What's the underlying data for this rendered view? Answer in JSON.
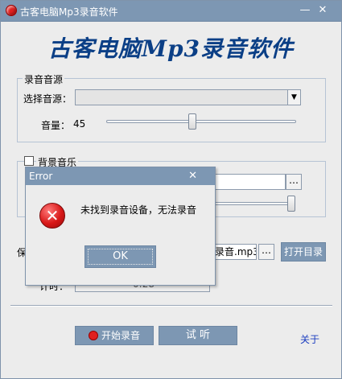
{
  "window": {
    "title": "古客电脑Mp3录音软件",
    "minimize_glyph": "—",
    "close_glyph": "✕"
  },
  "app_title": "古客电脑Mp3录音软件",
  "source_group": {
    "title": "录音音源",
    "select_label": "选择音源：",
    "select_value": "",
    "volume_label": "音量：",
    "volume_value": "45",
    "volume_level": 0.45
  },
  "bgm_group": {
    "title": "背景音乐",
    "checked": false,
    "volume_level": 1.0
  },
  "save": {
    "label_partial": "保",
    "filename": "录音.mp3",
    "browse_glyph": "…",
    "open_dir_label": "打开目录"
  },
  "timer": {
    "label": "计时：",
    "value": "0:28"
  },
  "buttons": {
    "start": "开始录音",
    "listen": "试  听",
    "about": "关于"
  },
  "dialog": {
    "title": "Error",
    "close_glyph": "✕",
    "message": "未找到录音设备，无法录音",
    "ok": "OK",
    "icon_glyph": "✕"
  }
}
